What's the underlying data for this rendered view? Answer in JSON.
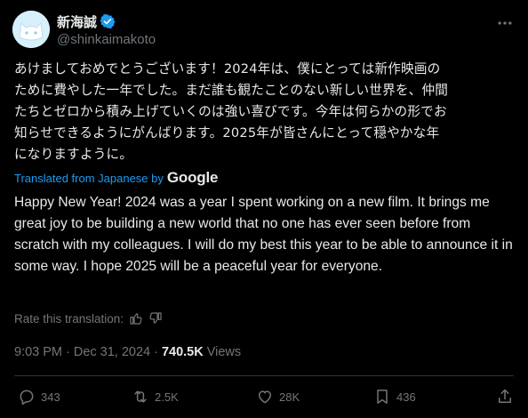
{
  "post": {
    "author": {
      "display_name": "新海誠",
      "handle": "@shinkaimakoto",
      "verified": true,
      "avatar_icon": "cat-avatar-icon",
      "avatar_color": "#d8f0fb"
    },
    "original_text": "あけましておめでとうございます！2024年は、僕にとっては新作映画の\nために費やした一年でした。まだ誰も観たことのない新しい世界を、仲間\nたちとゼロから積み上げていくのは強い喜びです。今年は何らかの形でお\n知らせできるようにがんばります。2025年が皆さんにとって穏やかな年\nになりますように。",
    "translation_label": "Translated from Japanese by",
    "translation_provider": "Google",
    "translated_text": "Happy New Year! 2024 was a year I spent working on a new film. It brings me great joy to be building a new world that no one has ever seen before from scratch with my colleagues. I will do my best this year to be able to announce it in some way. I hope 2025 will be a peaceful year for everyone.",
    "rate_label": "Rate this translation:",
    "time": "9:03 PM",
    "date": "Dec 31, 2024",
    "separator": "·",
    "views_count": "740.5K",
    "views_label": "Views"
  },
  "actions": {
    "replies": "343",
    "reposts": "2.5K",
    "likes": "28K",
    "bookmarks": "436"
  },
  "colors": {
    "background": "#000000",
    "text": "#e7e9ea",
    "muted": "#71767b",
    "accent": "#1d9bf0",
    "divider": "#2f3336"
  }
}
